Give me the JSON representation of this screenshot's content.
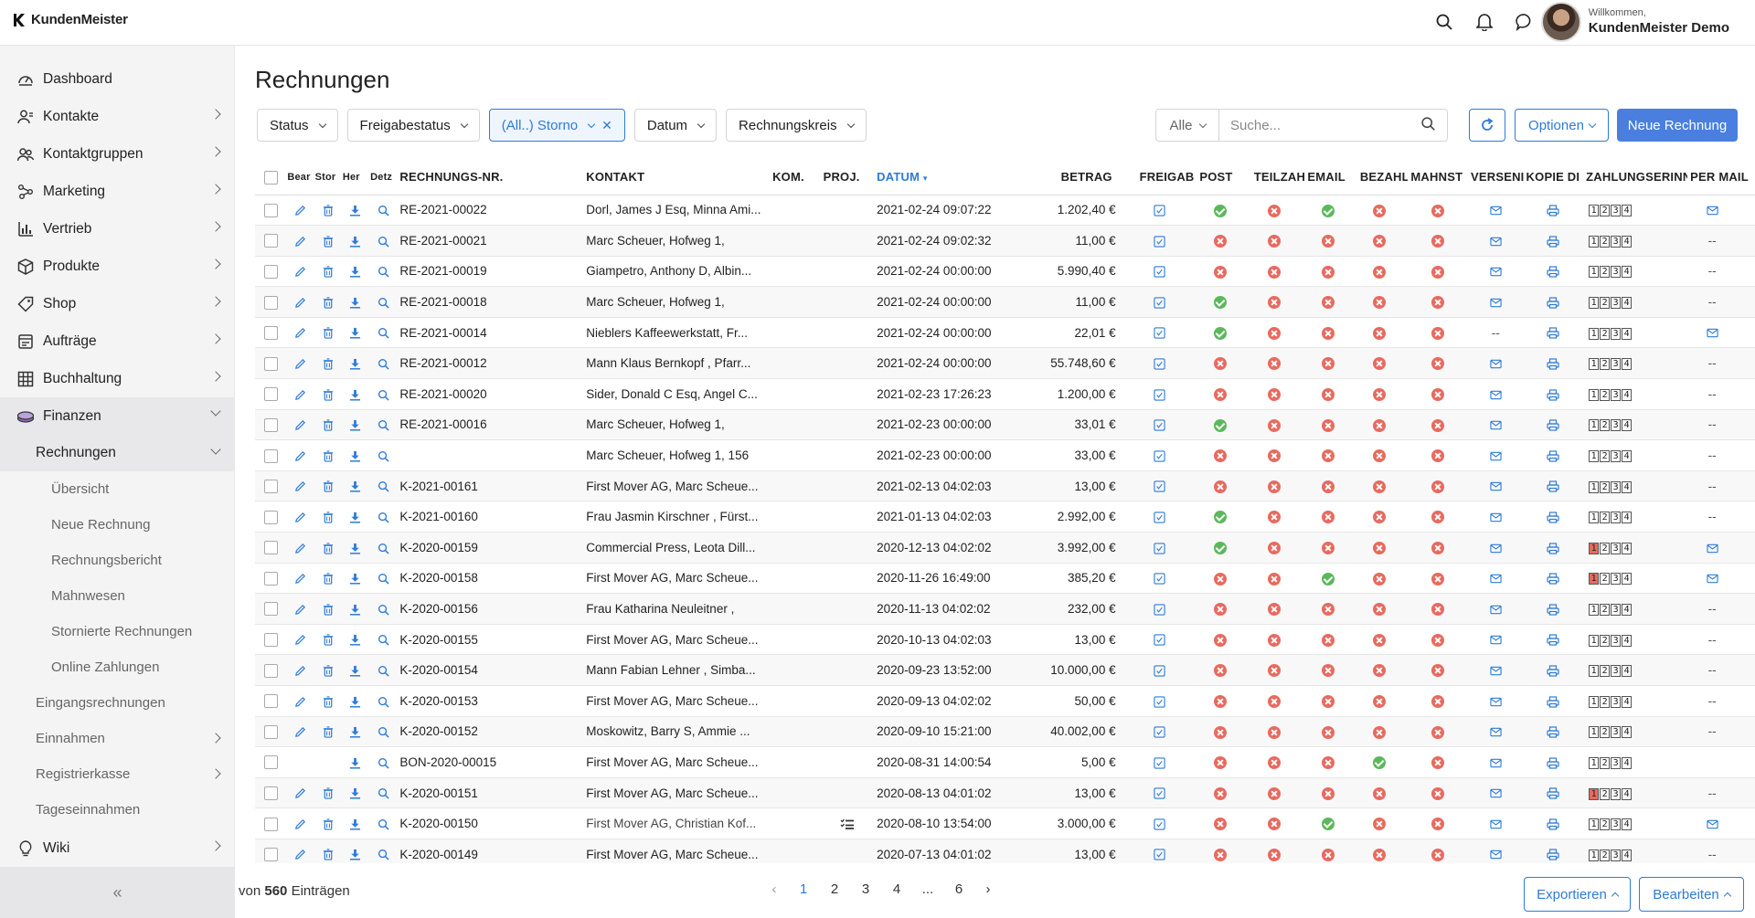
{
  "app": {
    "logo_text": "KundenMeister"
  },
  "user": {
    "welcome": "Willkommen,",
    "name": "KundenMeister Demo"
  },
  "sidebar": {
    "items": [
      {
        "label": "Dashboard",
        "icon": "dashboard-icon",
        "chevron": false
      },
      {
        "label": "Kontakte",
        "icon": "contacts-icon",
        "chevron": true
      },
      {
        "label": "Kontaktgruppen",
        "icon": "groups-icon",
        "chevron": true
      },
      {
        "label": "Marketing",
        "icon": "marketing-icon",
        "chevron": true
      },
      {
        "label": "Vertrieb",
        "icon": "chart-icon",
        "chevron": true
      },
      {
        "label": "Produkte",
        "icon": "box-icon",
        "chevron": true
      },
      {
        "label": "Shop",
        "icon": "tag-icon",
        "chevron": true
      },
      {
        "label": "Aufträge",
        "icon": "orders-icon",
        "chevron": true
      },
      {
        "label": "Buchhaltung",
        "icon": "ledger-icon",
        "chevron": true
      },
      {
        "label": "Finanzen",
        "icon": "finance-icon",
        "chevron": "down"
      }
    ],
    "finanzen_sub": {
      "active": "Rechnungen",
      "rechnungen_children": [
        "Übersicht",
        "Neue Rechnung",
        "Rechnungsbericht",
        "Mahnwesen",
        "Stornierte Rechnungen",
        "Online Zahlungen"
      ],
      "others": [
        {
          "label": "Eingangsrechnungen",
          "chevron": false
        },
        {
          "label": "Einnahmen",
          "chevron": true
        },
        {
          "label": "Registrierkasse",
          "chevron": true
        },
        {
          "label": "Tageseinnahmen",
          "chevron": false
        }
      ]
    },
    "wiki": "Wiki",
    "collapse": "«"
  },
  "main": {
    "title": "Rechnungen",
    "filters": [
      "Status",
      "Freigabestatus"
    ],
    "active_filter": "(All..) Storno",
    "filters2": [
      "Datum",
      "Rechnungskreis"
    ],
    "search_scope": "Alle",
    "search_placeholder": "Suche...",
    "options_label": "Optionen",
    "new_label": "Neue Rechnung"
  },
  "table": {
    "headers": {
      "bear": "Bear",
      "stor": "Stor",
      "herz": "Her",
      "det": "Detz",
      "nr": "RECHNUNGS-NR.",
      "kontakt": "KONTAKT",
      "kom": "KOM.",
      "proj": "PROJ.",
      "datum": "DATUM",
      "betrag": "BETRAG",
      "freigab": "FREIGAB",
      "post": "POST",
      "teilzah": "TEILZAH",
      "email": "EMAIL",
      "bezahlt": "BEZAHLT",
      "mahnst": "MAHNST",
      "versend": "VERSENI",
      "kopie": "KOPIE DI",
      "zahlung": "ZAHLUNGSERINN",
      "permail": "PER MAIL"
    },
    "rows": [
      {
        "nr": "RE-2021-00022",
        "kontakt": "Dorl, James J Esq, Minna Ami...",
        "datum": "2021-02-24 09:07:22",
        "betrag": "1.202,40 €",
        "post": "yes",
        "teil": "no",
        "email": "yes",
        "bez": "no",
        "mahn": "no",
        "vers": "mail",
        "mahnlvl": [
          0,
          0,
          0,
          0
        ],
        "per": "mail",
        "actions": "full",
        "proj": ""
      },
      {
        "nr": "RE-2021-00021",
        "kontakt": "Marc Scheuer, Hofweg 1,",
        "datum": "2021-02-24 09:02:32",
        "betrag": "11,00 €",
        "post": "no",
        "teil": "no",
        "email": "no",
        "bez": "no",
        "mahn": "no",
        "vers": "mail",
        "mahnlvl": [
          0,
          0,
          0,
          0
        ],
        "per": "--",
        "actions": "full",
        "proj": ""
      },
      {
        "nr": "RE-2021-00019",
        "kontakt": "Giampetro, Anthony D, Albin...",
        "datum": "2021-02-24 00:00:00",
        "betrag": "5.990,40 €",
        "post": "no",
        "teil": "no",
        "email": "no",
        "bez": "no",
        "mahn": "no",
        "vers": "mail",
        "mahnlvl": [
          0,
          0,
          0,
          0
        ],
        "per": "--",
        "actions": "full",
        "proj": ""
      },
      {
        "nr": "RE-2021-00018",
        "kontakt": "Marc Scheuer, Hofweg 1,",
        "datum": "2021-02-24 00:00:00",
        "betrag": "11,00 €",
        "post": "yes",
        "teil": "no",
        "email": "no",
        "bez": "no",
        "mahn": "no",
        "vers": "mail",
        "mahnlvl": [
          0,
          0,
          0,
          0
        ],
        "per": "--",
        "actions": "full",
        "proj": ""
      },
      {
        "nr": "RE-2021-00014",
        "kontakt": "Nieblers Kaffeewerkstatt, Fr...",
        "datum": "2021-02-24 00:00:00",
        "betrag": "22,01 €",
        "post": "yes",
        "teil": "no",
        "email": "no",
        "bez": "no",
        "mahn": "no",
        "vers": "--",
        "mahnlvl": [
          0,
          0,
          0,
          0
        ],
        "per": "mail",
        "actions": "full",
        "proj": ""
      },
      {
        "nr": "RE-2021-00012",
        "kontakt": "Mann Klaus Bernkopf , Pfarr...",
        "datum": "2021-02-24 00:00:00",
        "betrag": "55.748,60 €",
        "post": "no",
        "teil": "no",
        "email": "no",
        "bez": "no",
        "mahn": "no",
        "vers": "mail",
        "mahnlvl": [
          0,
          0,
          0,
          0
        ],
        "per": "--",
        "actions": "full",
        "proj": ""
      },
      {
        "nr": "RE-2021-00020",
        "kontakt": "Sider, Donald C Esq, Angel C...",
        "datum": "2021-02-23 17:26:23",
        "betrag": "1.200,00 €",
        "post": "no",
        "teil": "no",
        "email": "no",
        "bez": "no",
        "mahn": "no",
        "vers": "mail",
        "mahnlvl": [
          0,
          0,
          0,
          0
        ],
        "per": "--",
        "actions": "full",
        "proj": ""
      },
      {
        "nr": "RE-2021-00016",
        "kontakt": "Marc Scheuer, Hofweg 1,",
        "datum": "2021-02-23 00:00:00",
        "betrag": "33,01 €",
        "post": "yes",
        "teil": "no",
        "email": "no",
        "bez": "no",
        "mahn": "no",
        "vers": "mail",
        "mahnlvl": [
          0,
          0,
          0,
          0
        ],
        "per": "--",
        "actions": "full",
        "proj": ""
      },
      {
        "nr": "",
        "kontakt": "Marc Scheuer, Hofweg 1, 156",
        "datum": "2021-02-23 00:00:00",
        "betrag": "33,00 €",
        "post": "no",
        "teil": "no",
        "email": "no",
        "bez": "no",
        "mahn": "no",
        "vers": "mail",
        "mahnlvl": [
          0,
          0,
          0,
          0
        ],
        "per": "--",
        "actions": "full",
        "proj": ""
      },
      {
        "nr": "K-2021-00161",
        "kontakt": "First Mover AG, Marc Scheue...",
        "datum": "2021-02-13 04:02:03",
        "betrag": "13,00 €",
        "post": "no",
        "teil": "no",
        "email": "no",
        "bez": "no",
        "mahn": "no",
        "vers": "mail",
        "mahnlvl": [
          0,
          0,
          0,
          0
        ],
        "per": "--",
        "actions": "full",
        "proj": ""
      },
      {
        "nr": "K-2021-00160",
        "kontakt": "Frau Jasmin Kirschner , Fürst...",
        "datum": "2021-01-13 04:02:03",
        "betrag": "2.992,00 €",
        "post": "yes",
        "teil": "no",
        "email": "no",
        "bez": "no",
        "mahn": "no",
        "vers": "mail",
        "mahnlvl": [
          0,
          0,
          0,
          0
        ],
        "per": "--",
        "actions": "full",
        "proj": ""
      },
      {
        "nr": "K-2020-00159",
        "kontakt": "Commercial Press, Leota Dill...",
        "datum": "2020-12-13 04:02:02",
        "betrag": "3.992,00 €",
        "post": "yes",
        "teil": "no",
        "email": "no",
        "bez": "no",
        "mahn": "no",
        "vers": "mail",
        "mahnlvl": [
          1,
          0,
          0,
          0
        ],
        "per": "mail",
        "actions": "full",
        "proj": ""
      },
      {
        "nr": "K-2020-00158",
        "kontakt": "First Mover AG, Marc Scheue...",
        "datum": "2020-11-26 16:49:00",
        "betrag": "385,20 €",
        "post": "no",
        "teil": "no",
        "email": "yes",
        "bez": "no",
        "mahn": "no",
        "vers": "mail",
        "mahnlvl": [
          1,
          0,
          0,
          0
        ],
        "per": "mail",
        "actions": "full",
        "proj": ""
      },
      {
        "nr": "K-2020-00156",
        "kontakt": "Frau Katharina Neuleitner ,",
        "datum": "2020-11-13 04:02:02",
        "betrag": "232,00 €",
        "post": "no",
        "teil": "no",
        "email": "no",
        "bez": "no",
        "mahn": "no",
        "vers": "mail",
        "mahnlvl": [
          0,
          0,
          0,
          0
        ],
        "per": "--",
        "actions": "full",
        "proj": ""
      },
      {
        "nr": "K-2020-00155",
        "kontakt": "First Mover AG, Marc Scheue...",
        "datum": "2020-10-13 04:02:03",
        "betrag": "13,00 €",
        "post": "no",
        "teil": "no",
        "email": "no",
        "bez": "no",
        "mahn": "no",
        "vers": "mail",
        "mahnlvl": [
          0,
          0,
          0,
          0
        ],
        "per": "--",
        "actions": "full",
        "proj": ""
      },
      {
        "nr": "K-2020-00154",
        "kontakt": "Mann Fabian Lehner , Simba...",
        "datum": "2020-09-23 13:52:00",
        "betrag": "10.000,00 €",
        "post": "no",
        "teil": "no",
        "email": "no",
        "bez": "no",
        "mahn": "no",
        "vers": "mail",
        "mahnlvl": [
          0,
          0,
          0,
          0
        ],
        "per": "--",
        "actions": "full",
        "proj": ""
      },
      {
        "nr": "K-2020-00153",
        "kontakt": "First Mover AG, Marc Scheue...",
        "datum": "2020-09-13 04:02:02",
        "betrag": "50,00 €",
        "post": "no",
        "teil": "no",
        "email": "no",
        "bez": "no",
        "mahn": "no",
        "vers": "mail",
        "mahnlvl": [
          0,
          0,
          0,
          0
        ],
        "per": "--",
        "actions": "full",
        "proj": ""
      },
      {
        "nr": "K-2020-00152",
        "kontakt": "Moskowitz, Barry S, Ammie ...",
        "datum": "2020-09-10 15:21:00",
        "betrag": "40.002,00 €",
        "post": "no",
        "teil": "no",
        "email": "no",
        "bez": "no",
        "mahn": "no",
        "vers": "mail",
        "mahnlvl": [
          0,
          0,
          0,
          0
        ],
        "per": "--",
        "actions": "full",
        "proj": ""
      },
      {
        "nr": "BON-2020-00015",
        "kontakt": "First Mover AG, Marc Scheue...",
        "datum": "2020-08-31 14:00:54",
        "betrag": "5,00 €",
        "post": "no",
        "teil": "no",
        "email": "no",
        "bez": "yes",
        "mahn": "no",
        "vers": "mail",
        "mahnlvl": [
          0,
          0,
          0,
          0
        ],
        "per": "",
        "actions": "bon",
        "proj": ""
      },
      {
        "nr": "K-2020-00151",
        "kontakt": "First Mover AG, Marc Scheue...",
        "datum": "2020-08-13 04:01:02",
        "betrag": "13,00 €",
        "post": "no",
        "teil": "no",
        "email": "no",
        "bez": "no",
        "mahn": "no",
        "vers": "mail",
        "mahnlvl": [
          1,
          0,
          0,
          0
        ],
        "per": "--",
        "actions": "full",
        "proj": ""
      },
      {
        "nr": "K-2020-00150",
        "kontakt": "First Mover AG, Christian Kof...",
        "datum": "2020-08-10 13:54:00",
        "betrag": "3.000,00 €",
        "post": "no",
        "teil": "no",
        "email": "yes",
        "bez": "no",
        "mahn": "no",
        "vers": "mail",
        "mahnlvl": [
          0,
          0,
          0,
          0
        ],
        "per": "mail",
        "actions": "full",
        "proj": "tasks",
        "dim": true
      },
      {
        "nr": "K-2020-00149",
        "kontakt": "First Mover AG, Marc Scheue...",
        "datum": "2020-07-13 04:01:02",
        "betrag": "13,00 €",
        "post": "no",
        "teil": "no",
        "email": "no",
        "bez": "no",
        "mahn": "no",
        "vers": "mail",
        "mahnlvl": [
          0,
          0,
          0,
          0
        ],
        "per": "--",
        "actions": "full",
        "proj": ""
      }
    ]
  },
  "footer": {
    "count_prefix": "von",
    "count": "560",
    "count_suffix": "Einträgen",
    "pages": [
      "1",
      "2",
      "3",
      "4",
      "...",
      "6"
    ],
    "current_page": "1",
    "prev": "‹",
    "next": "›",
    "export_label": "Exportieren",
    "edit_label": "Bearbeiten"
  },
  "colors": {
    "accent": "#2e7bd6",
    "primary_button": "#4a7fe0",
    "status_no": "#e86a5f",
    "status_yes": "#5cb85c"
  }
}
